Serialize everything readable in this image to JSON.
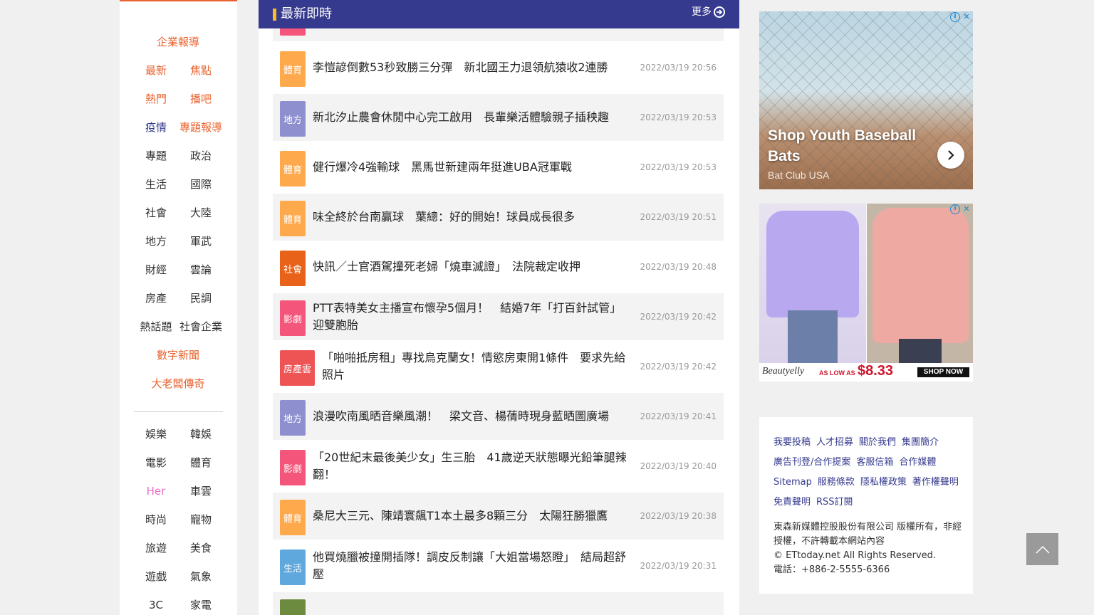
{
  "left_nav": {
    "groups_top": [
      [
        {
          "label": "企業報導",
          "color": "orange"
        }
      ],
      [
        {
          "label": "最新",
          "color": "orange"
        },
        {
          "label": "焦點",
          "color": "orange"
        }
      ],
      [
        {
          "label": "熱門",
          "color": "orange"
        },
        {
          "label": "播吧",
          "color": "orange"
        }
      ],
      [
        {
          "label": "疫情",
          "color": "navy"
        },
        {
          "label": "專題報導",
          "color": "orange"
        }
      ],
      [
        {
          "label": "專題",
          "color": "dark"
        },
        {
          "label": "政治",
          "color": "dark"
        }
      ],
      [
        {
          "label": "生活",
          "color": "dark"
        },
        {
          "label": "國際",
          "color": "dark"
        }
      ],
      [
        {
          "label": "社會",
          "color": "dark"
        },
        {
          "label": "大陸",
          "color": "dark"
        }
      ],
      [
        {
          "label": "地方",
          "color": "dark"
        },
        {
          "label": "軍武",
          "color": "dark"
        }
      ],
      [
        {
          "label": "財經",
          "color": "dark"
        },
        {
          "label": "雲論",
          "color": "dark"
        }
      ],
      [
        {
          "label": "房產",
          "color": "dark"
        },
        {
          "label": "民調",
          "color": "dark"
        }
      ],
      [
        {
          "label": "熱話題",
          "color": "dark"
        },
        {
          "label": "社會企業",
          "color": "dark"
        }
      ],
      [
        {
          "label": "數字新聞",
          "color": "orange"
        }
      ],
      [
        {
          "label": "大老闆傳奇",
          "color": "orange"
        }
      ]
    ],
    "groups_bottom": [
      [
        {
          "label": "娛樂",
          "color": "dark"
        },
        {
          "label": "韓娛",
          "color": "dark"
        }
      ],
      [
        {
          "label": "電影",
          "color": "dark"
        },
        {
          "label": "體育",
          "color": "dark"
        }
      ],
      [
        {
          "label": "Her",
          "color": "pink"
        },
        {
          "label": "車雲",
          "color": "dark"
        }
      ],
      [
        {
          "label": "時尚",
          "color": "dark"
        },
        {
          "label": "寵物",
          "color": "dark"
        }
      ],
      [
        {
          "label": "旅遊",
          "color": "dark"
        },
        {
          "label": "美食",
          "color": "dark"
        }
      ],
      [
        {
          "label": "遊戲",
          "color": "dark"
        },
        {
          "label": "氣象",
          "color": "dark"
        }
      ],
      [
        {
          "label": "3C",
          "color": "dark"
        },
        {
          "label": "家電",
          "color": "dark"
        }
      ]
    ]
  },
  "news": {
    "header_title": "最新即時",
    "more_label": "更多",
    "items": [
      {
        "category": "體育",
        "color": "#ffa94d",
        "title": "李愷諺倒數53秒致勝三分彈　新北國王力退領航猿收2連勝",
        "time": "2022/03/19 20:56"
      },
      {
        "category": "地方",
        "color": "#8d8fce",
        "title": "新北汐止農會休閒中心完工啟用　長輩樂活體驗親子插秧趣",
        "time": "2022/03/19 20:53"
      },
      {
        "category": "體育",
        "color": "#ffa94d",
        "title": "健行爆冷4強輸球　黑馬世新建兩年挺進UBA冠軍戰",
        "time": "2022/03/19 20:53"
      },
      {
        "category": "體育",
        "color": "#ffa94d",
        "title": "味全終於台南贏球　葉總：好的開始！球員成長很多",
        "time": "2022/03/19 20:51"
      },
      {
        "category": "社會",
        "color": "#e8621a",
        "title": "快訊／士官酒駕撞死老婦「燒車滅證」　法院裁定收押",
        "time": "2022/03/19 20:48"
      },
      {
        "category": "影劇",
        "color": "#f4557a",
        "title": "PTT表特美女主播宣布懷孕5個月！　結婚7年「打百針試管」迎雙胞胎",
        "time": "2022/03/19 20:42"
      },
      {
        "category": "房產雲",
        "color": "#ee5454",
        "title": "「啪啪抵房租」專找烏克蘭女！情慾房東開1條件　要求先給照片",
        "time": "2022/03/19 20:42"
      },
      {
        "category": "地方",
        "color": "#8d8fce",
        "title": "浪漫吹南風晒音樂風潮！　梁文音、楊蒨時現身藍晒圖廣場",
        "time": "2022/03/19 20:41"
      },
      {
        "category": "影劇",
        "color": "#f4557a",
        "title": "「20世紀末最後美少女」生三胎　41歲逆天狀態曝光鉛筆腿辣翻！",
        "time": "2022/03/19 20:40"
      },
      {
        "category": "體育",
        "color": "#ffa94d",
        "title": "桑尼大三元、陳靖寰飆T1本土最多8顆三分　太陽狂勝獵鷹",
        "time": "2022/03/19 20:38"
      },
      {
        "category": "生活",
        "color": "#5fa8dd",
        "title": "他買燒臘被撞開插隊！調皮反制讓「大姐當場怒瞪」　結局超舒壓",
        "time": "2022/03/19 20:31"
      },
      {
        "category": "",
        "color": "#6d8b3e",
        "title": "",
        "time": ""
      }
    ]
  },
  "ad1": {
    "headline": "Shop Youth Baseball Bats",
    "brand": "Bat Club USA"
  },
  "ad2": {
    "brand_logo": "Beautyelly",
    "as_low_as": "AS LOW AS",
    "price": "$8.33",
    "cta": "SHOP NOW"
  },
  "footer": {
    "links": [
      "我要投稿",
      "人才招募",
      "關於我們",
      "集團簡介",
      "廣告刊登/合作提案",
      "客服信箱",
      "合作媒體",
      "Sitemap",
      "服務條款",
      "隱私權政策",
      "著作權聲明",
      "免責聲明",
      "RSS訂閱"
    ],
    "copyright_lines": [
      "東森新媒體控股股份有限公司 版權所有，非經授權，不許轉載本網站內容",
      "© ETtoday.net All Rights Reserved.",
      "電話：+886-2-5555-6366"
    ]
  }
}
